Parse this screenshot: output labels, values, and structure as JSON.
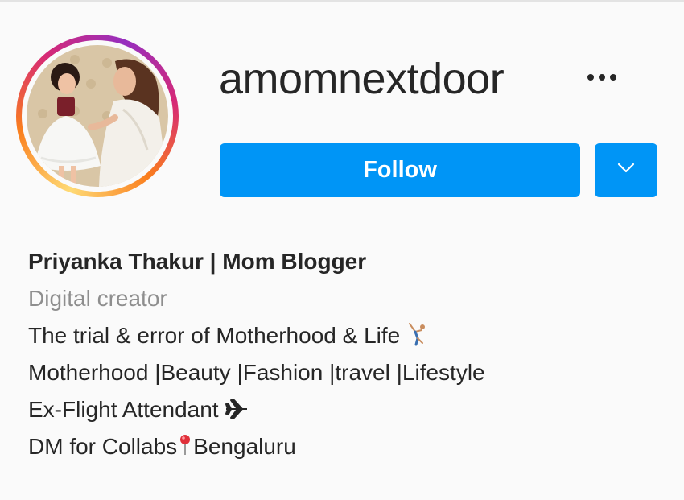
{
  "profile": {
    "username": "amomnextdoor",
    "follow_label": "Follow",
    "more_icon": "more-options-icon",
    "dropdown_icon": "chevron-down-icon"
  },
  "bio": {
    "name": "Priyanka Thakur | Mom Blogger",
    "category": "Digital creator",
    "line1": "The trial & error of Motherhood & Life",
    "line2": "Motherhood |Beauty |Fashion |travel |Lifestyle",
    "line3": "Ex-Flight Attendant",
    "line4_a": "DM for Collabs",
    "line4_b": "Bengaluru"
  },
  "colors": {
    "accent": "#0095f6",
    "text": "#262626",
    "secondary_text": "#8e8e8e",
    "background": "#fafafa"
  }
}
